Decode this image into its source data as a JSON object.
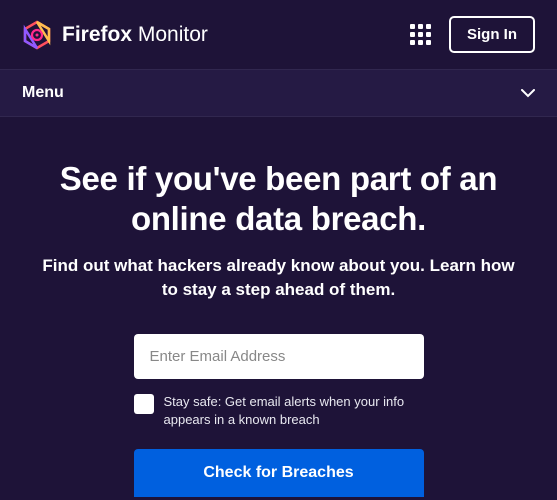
{
  "header": {
    "brand_bold": "Firefox",
    "brand_light": "Monitor",
    "signin_label": "Sign In"
  },
  "menu": {
    "label": "Menu"
  },
  "hero": {
    "title": "See if you've been part of an online data breach.",
    "subtitle": "Find out what hackers already know about you. Learn how to stay a step ahead of them."
  },
  "form": {
    "email_placeholder": "Enter Email Address",
    "checkbox_label": "Stay safe: Get email alerts when your info appears in a known breach",
    "submit_label": "Check for Breaches"
  }
}
